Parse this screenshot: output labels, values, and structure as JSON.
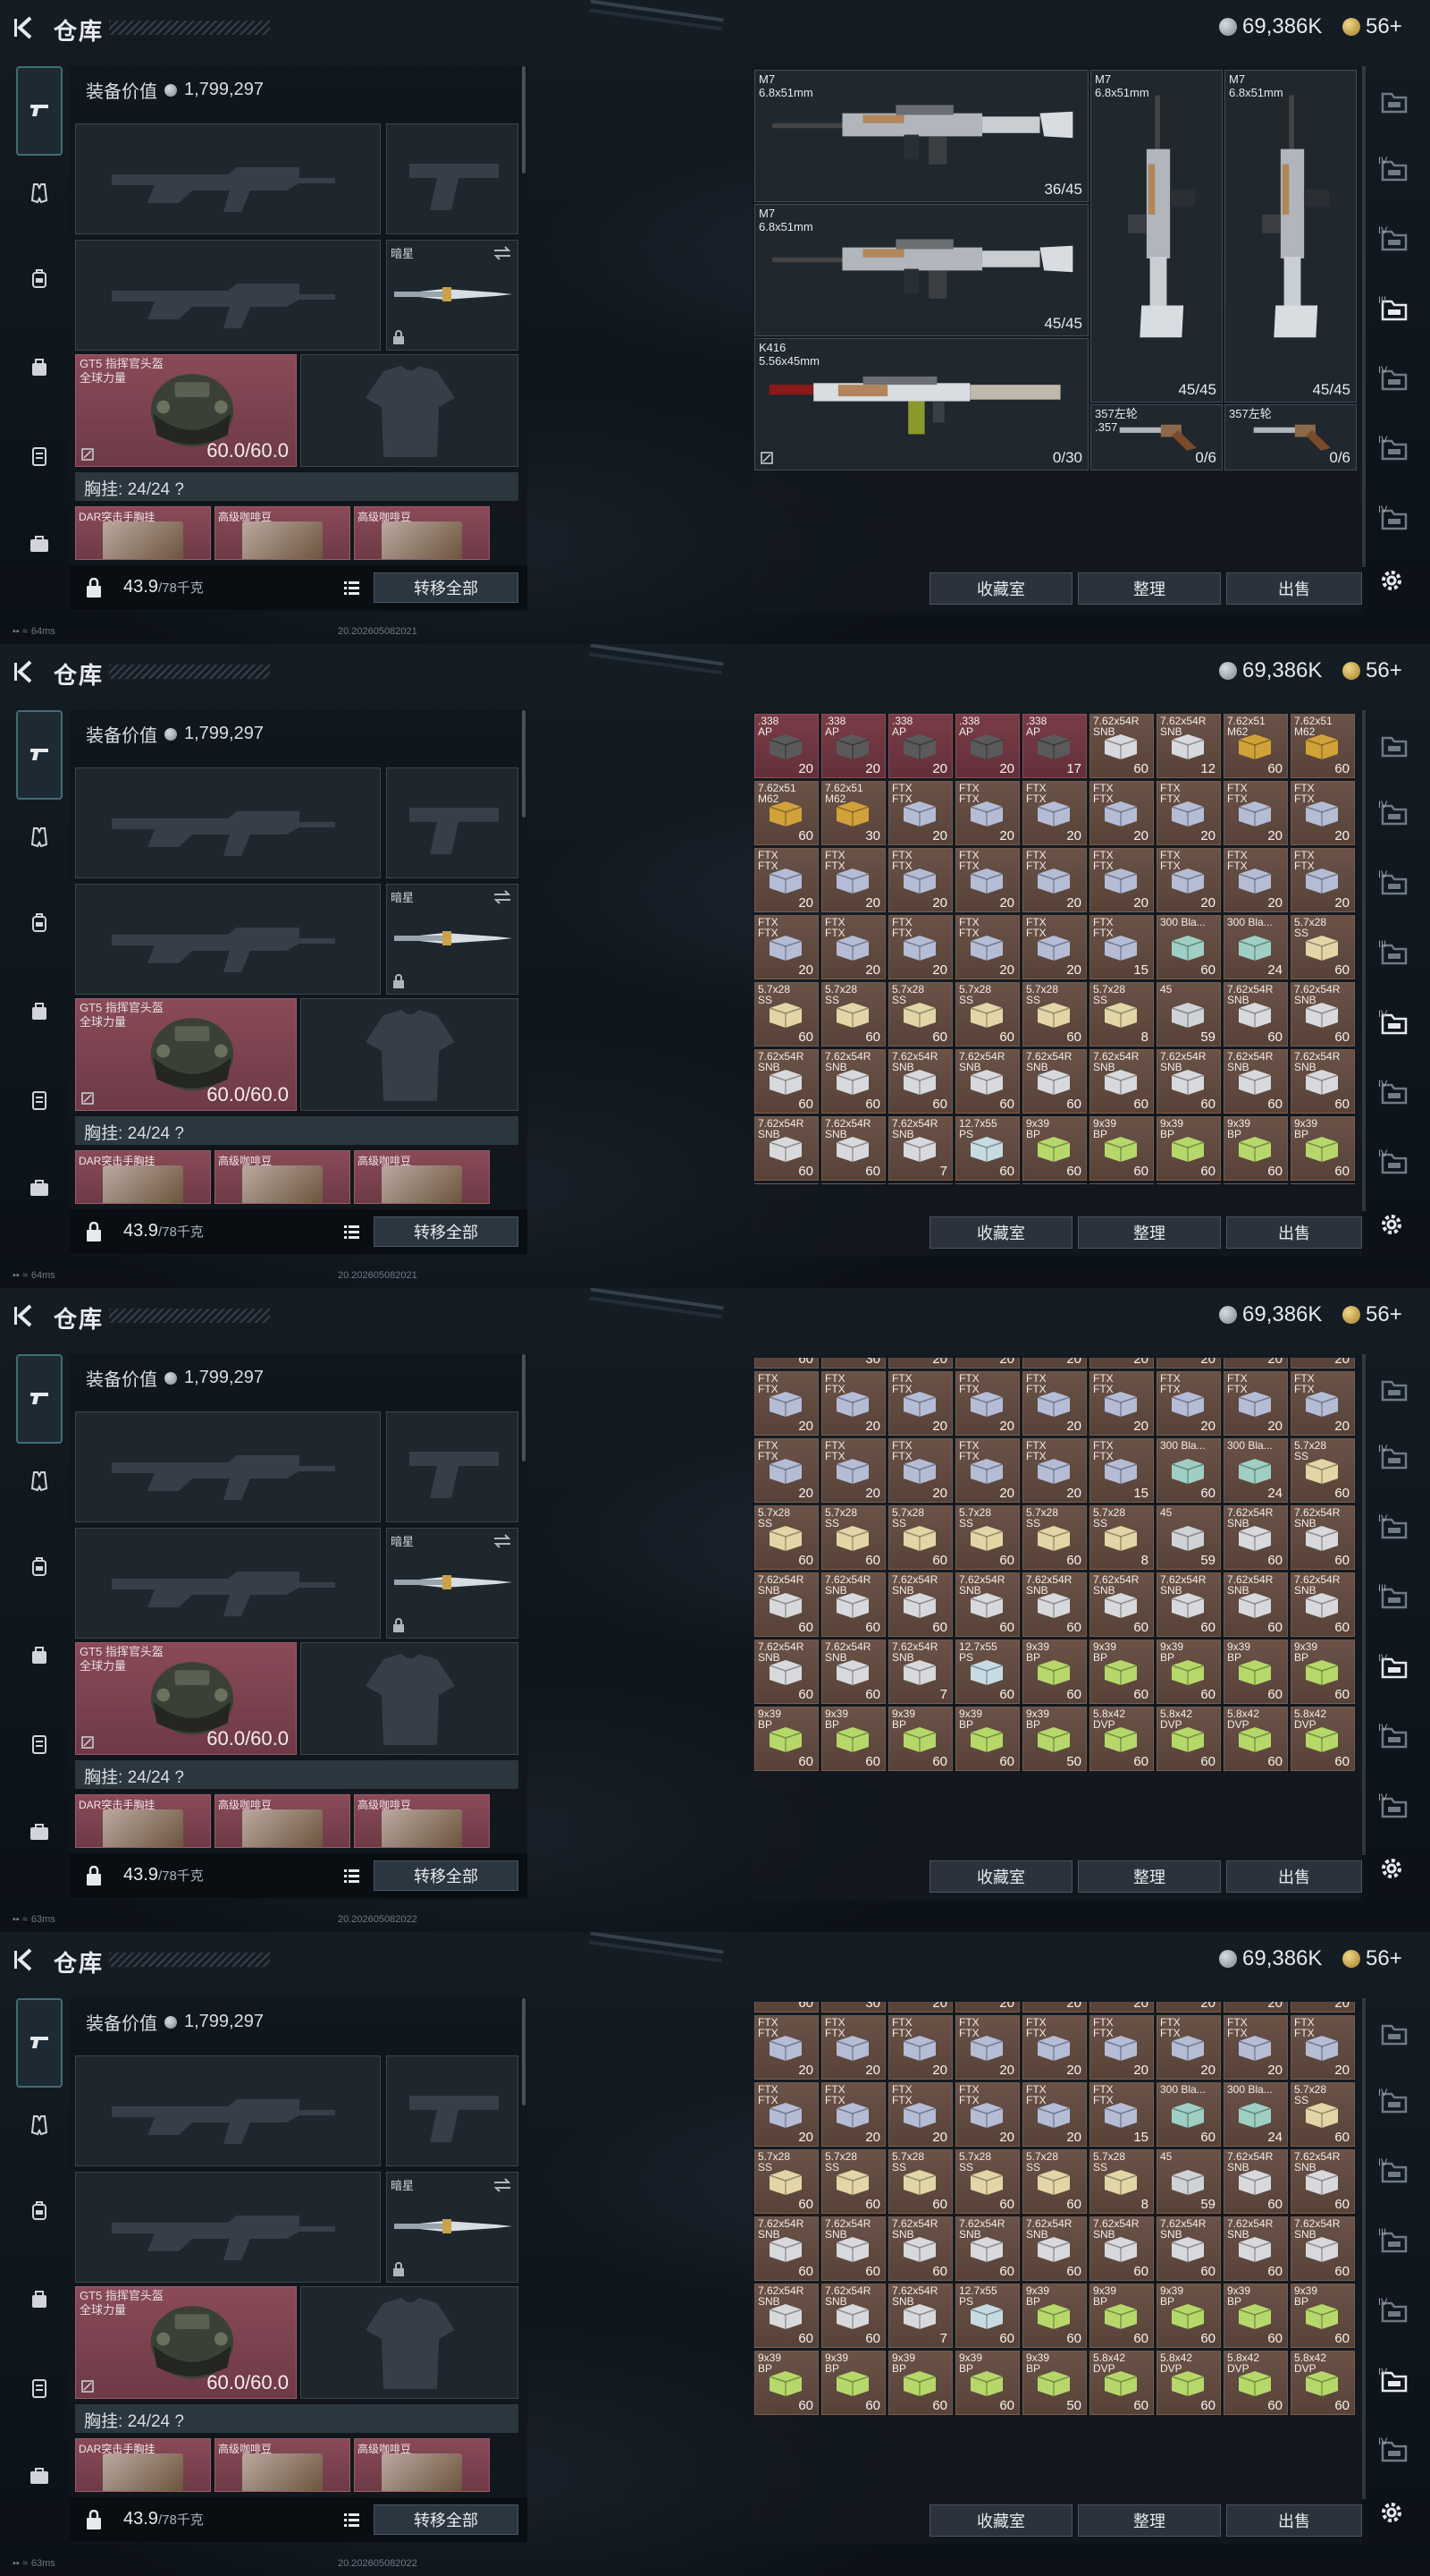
{
  "header": {
    "title": "仓库",
    "silver_amount": "69,386K",
    "gold_amount": "56+"
  },
  "loadout": {
    "equip_value_label": "装备价值",
    "equip_value": "1,799,297",
    "melee_name": "暗星",
    "helmet_name": "GT5 指挥官头盔",
    "helmet_tag": "全球力量",
    "helmet_durability": "60.0/60.0",
    "rig_label": "胸挂:",
    "rig_capacity": "24/24",
    "rig_help": "?",
    "rig_items": [
      "DAR突击手胸挂",
      "高级咖啡豆",
      "高级咖啡豆"
    ],
    "weight": "43.9",
    "weight_max": "/78千克",
    "transfer_all": "转移全部"
  },
  "storage": {
    "weapons": [
      {
        "name": "M7",
        "caliber": "6.8x51mm",
        "ammo": "36/45"
      },
      {
        "name": "M7",
        "caliber": "6.8x51mm",
        "ammo": "45/45"
      },
      {
        "name": "M7",
        "caliber": "6.8x51mm",
        "ammo": "45/45"
      },
      {
        "name": "M7",
        "caliber": "6.8x51mm",
        "ammo": "45/45"
      },
      {
        "name": "K416",
        "caliber": "5.56x45mm",
        "ammo": "0/30"
      },
      {
        "name": "357左轮",
        "caliber": ".357",
        "ammo": "0/6"
      },
      {
        "name": "357左轮",
        "caliber": "",
        "ammo": "0/6"
      }
    ],
    "ammo_rows": [
      [
        [
          ".338",
          "AP",
          "20",
          "red"
        ],
        [
          ".338",
          "AP",
          "20",
          "red"
        ],
        [
          ".338",
          "AP",
          "20",
          "red"
        ],
        [
          ".338",
          "AP",
          "20",
          "red"
        ],
        [
          ".338",
          "AP",
          "17",
          "red"
        ],
        [
          "7.62x54R",
          "SNB",
          "60",
          ""
        ],
        [
          "7.62x54R",
          "SNB",
          "12",
          ""
        ],
        [
          "7.62x51",
          "M62",
          "60",
          ""
        ],
        [
          "7.62x51",
          "M62",
          "60",
          ""
        ]
      ],
      [
        [
          "7.62x51",
          "M62",
          "60",
          ""
        ],
        [
          "7.62x51",
          "M62",
          "30",
          ""
        ],
        [
          "FTX",
          "FTX",
          "20",
          ""
        ],
        [
          "FTX",
          "FTX",
          "20",
          ""
        ],
        [
          "FTX",
          "FTX",
          "20",
          ""
        ],
        [
          "FTX",
          "FTX",
          "20",
          ""
        ],
        [
          "FTX",
          "FTX",
          "20",
          ""
        ],
        [
          "FTX",
          "FTX",
          "20",
          ""
        ],
        [
          "FTX",
          "FTX",
          "20",
          ""
        ]
      ],
      [
        [
          "FTX",
          "FTX",
          "20",
          ""
        ],
        [
          "FTX",
          "FTX",
          "20",
          ""
        ],
        [
          "FTX",
          "FTX",
          "20",
          ""
        ],
        [
          "FTX",
          "FTX",
          "20",
          ""
        ],
        [
          "FTX",
          "FTX",
          "20",
          ""
        ],
        [
          "FTX",
          "FTX",
          "20",
          ""
        ],
        [
          "FTX",
          "FTX",
          "20",
          ""
        ],
        [
          "FTX",
          "FTX",
          "20",
          ""
        ],
        [
          "FTX",
          "FTX",
          "20",
          ""
        ]
      ],
      [
        [
          "FTX",
          "FTX",
          "20",
          ""
        ],
        [
          "FTX",
          "FTX",
          "20",
          ""
        ],
        [
          "FTX",
          "FTX",
          "20",
          ""
        ],
        [
          "FTX",
          "FTX",
          "20",
          ""
        ],
        [
          "FTX",
          "FTX",
          "20",
          ""
        ],
        [
          "FTX",
          "FTX",
          "15",
          ""
        ],
        [
          "300 Bla...",
          "",
          "60",
          ""
        ],
        [
          "300 Bla...",
          "",
          "24",
          ""
        ],
        [
          "5.7x28",
          "SS",
          "60",
          ""
        ]
      ],
      [
        [
          "5.7x28",
          "SS",
          "60",
          ""
        ],
        [
          "5.7x28",
          "SS",
          "60",
          ""
        ],
        [
          "5.7x28",
          "SS",
          "60",
          ""
        ],
        [
          "5.7x28",
          "SS",
          "60",
          ""
        ],
        [
          "5.7x28",
          "SS",
          "60",
          ""
        ],
        [
          "5.7x28",
          "SS",
          "8",
          ""
        ],
        [
          "45",
          "",
          "59",
          ""
        ],
        [
          "7.62x54R",
          "SNB",
          "60",
          ""
        ],
        [
          "7.62x54R",
          "SNB",
          "60",
          ""
        ]
      ],
      [
        [
          "7.62x54R",
          "SNB",
          "60",
          ""
        ],
        [
          "7.62x54R",
          "SNB",
          "60",
          ""
        ],
        [
          "7.62x54R",
          "SNB",
          "60",
          ""
        ],
        [
          "7.62x54R",
          "SNB",
          "60",
          ""
        ],
        [
          "7.62x54R",
          "SNB",
          "60",
          ""
        ],
        [
          "7.62x54R",
          "SNB",
          "60",
          ""
        ],
        [
          "7.62x54R",
          "SNB",
          "60",
          ""
        ],
        [
          "7.62x54R",
          "SNB",
          "60",
          ""
        ],
        [
          "7.62x54R",
          "SNB",
          "60",
          ""
        ]
      ],
      [
        [
          "7.62x54R",
          "SNB",
          "60",
          ""
        ],
        [
          "7.62x54R",
          "SNB",
          "60",
          ""
        ],
        [
          "7.62x54R",
          "SNB",
          "7",
          ""
        ],
        [
          "12.7x55",
          "PS",
          "60",
          ""
        ],
        [
          "9x39",
          "BP",
          "60",
          ""
        ],
        [
          "9x39",
          "BP",
          "60",
          ""
        ],
        [
          "9x39",
          "BP",
          "60",
          ""
        ],
        [
          "9x39",
          "BP",
          "60",
          ""
        ],
        [
          "9x39",
          "BP",
          "60",
          ""
        ]
      ],
      [
        [
          "9x39",
          "BP",
          "60",
          ""
        ],
        [
          "9x39",
          "BP",
          "60",
          ""
        ],
        [
          "9x39",
          "BP",
          "60",
          ""
        ],
        [
          "9x39",
          "BP",
          "60",
          ""
        ],
        [
          "9x39",
          "BP",
          "50",
          ""
        ],
        [
          "5.8x42",
          "DVP",
          "60",
          ""
        ],
        [
          "5.8x42",
          "DVP",
          "60",
          ""
        ],
        [
          "5.8x42",
          "DVP",
          "60",
          ""
        ],
        [
          "5.8x42",
          "DVP",
          "60",
          ""
        ]
      ]
    ],
    "buttons": [
      "收藏室",
      "整理",
      "出售"
    ]
  },
  "status": {
    "ping_frame1": "64ms",
    "ping_frame2": "64ms",
    "ping_frame3": "63ms",
    "ping_frame4": "63ms",
    "build_frame1": "20.202605082021",
    "build_frame2": "20.202605082021",
    "build_frame3": "20.202605082022",
    "build_frame4": "20.202605082022"
  },
  "colors": {
    "accent_teal": "#3f6e73",
    "helmet_red": "#8a4a58",
    "ammo_brown": "#6a5247"
  },
  "icons": [
    "back-icon",
    "silver-coin-icon",
    "gold-coin-icon",
    "pistol-icon",
    "vest-icon",
    "backpack-icon",
    "bag-icon",
    "pouch-icon",
    "case-icon",
    "helmet-icon",
    "swap-icon",
    "lock-icon",
    "list-icon",
    "gear-icon",
    "storage-tab-icon"
  ]
}
